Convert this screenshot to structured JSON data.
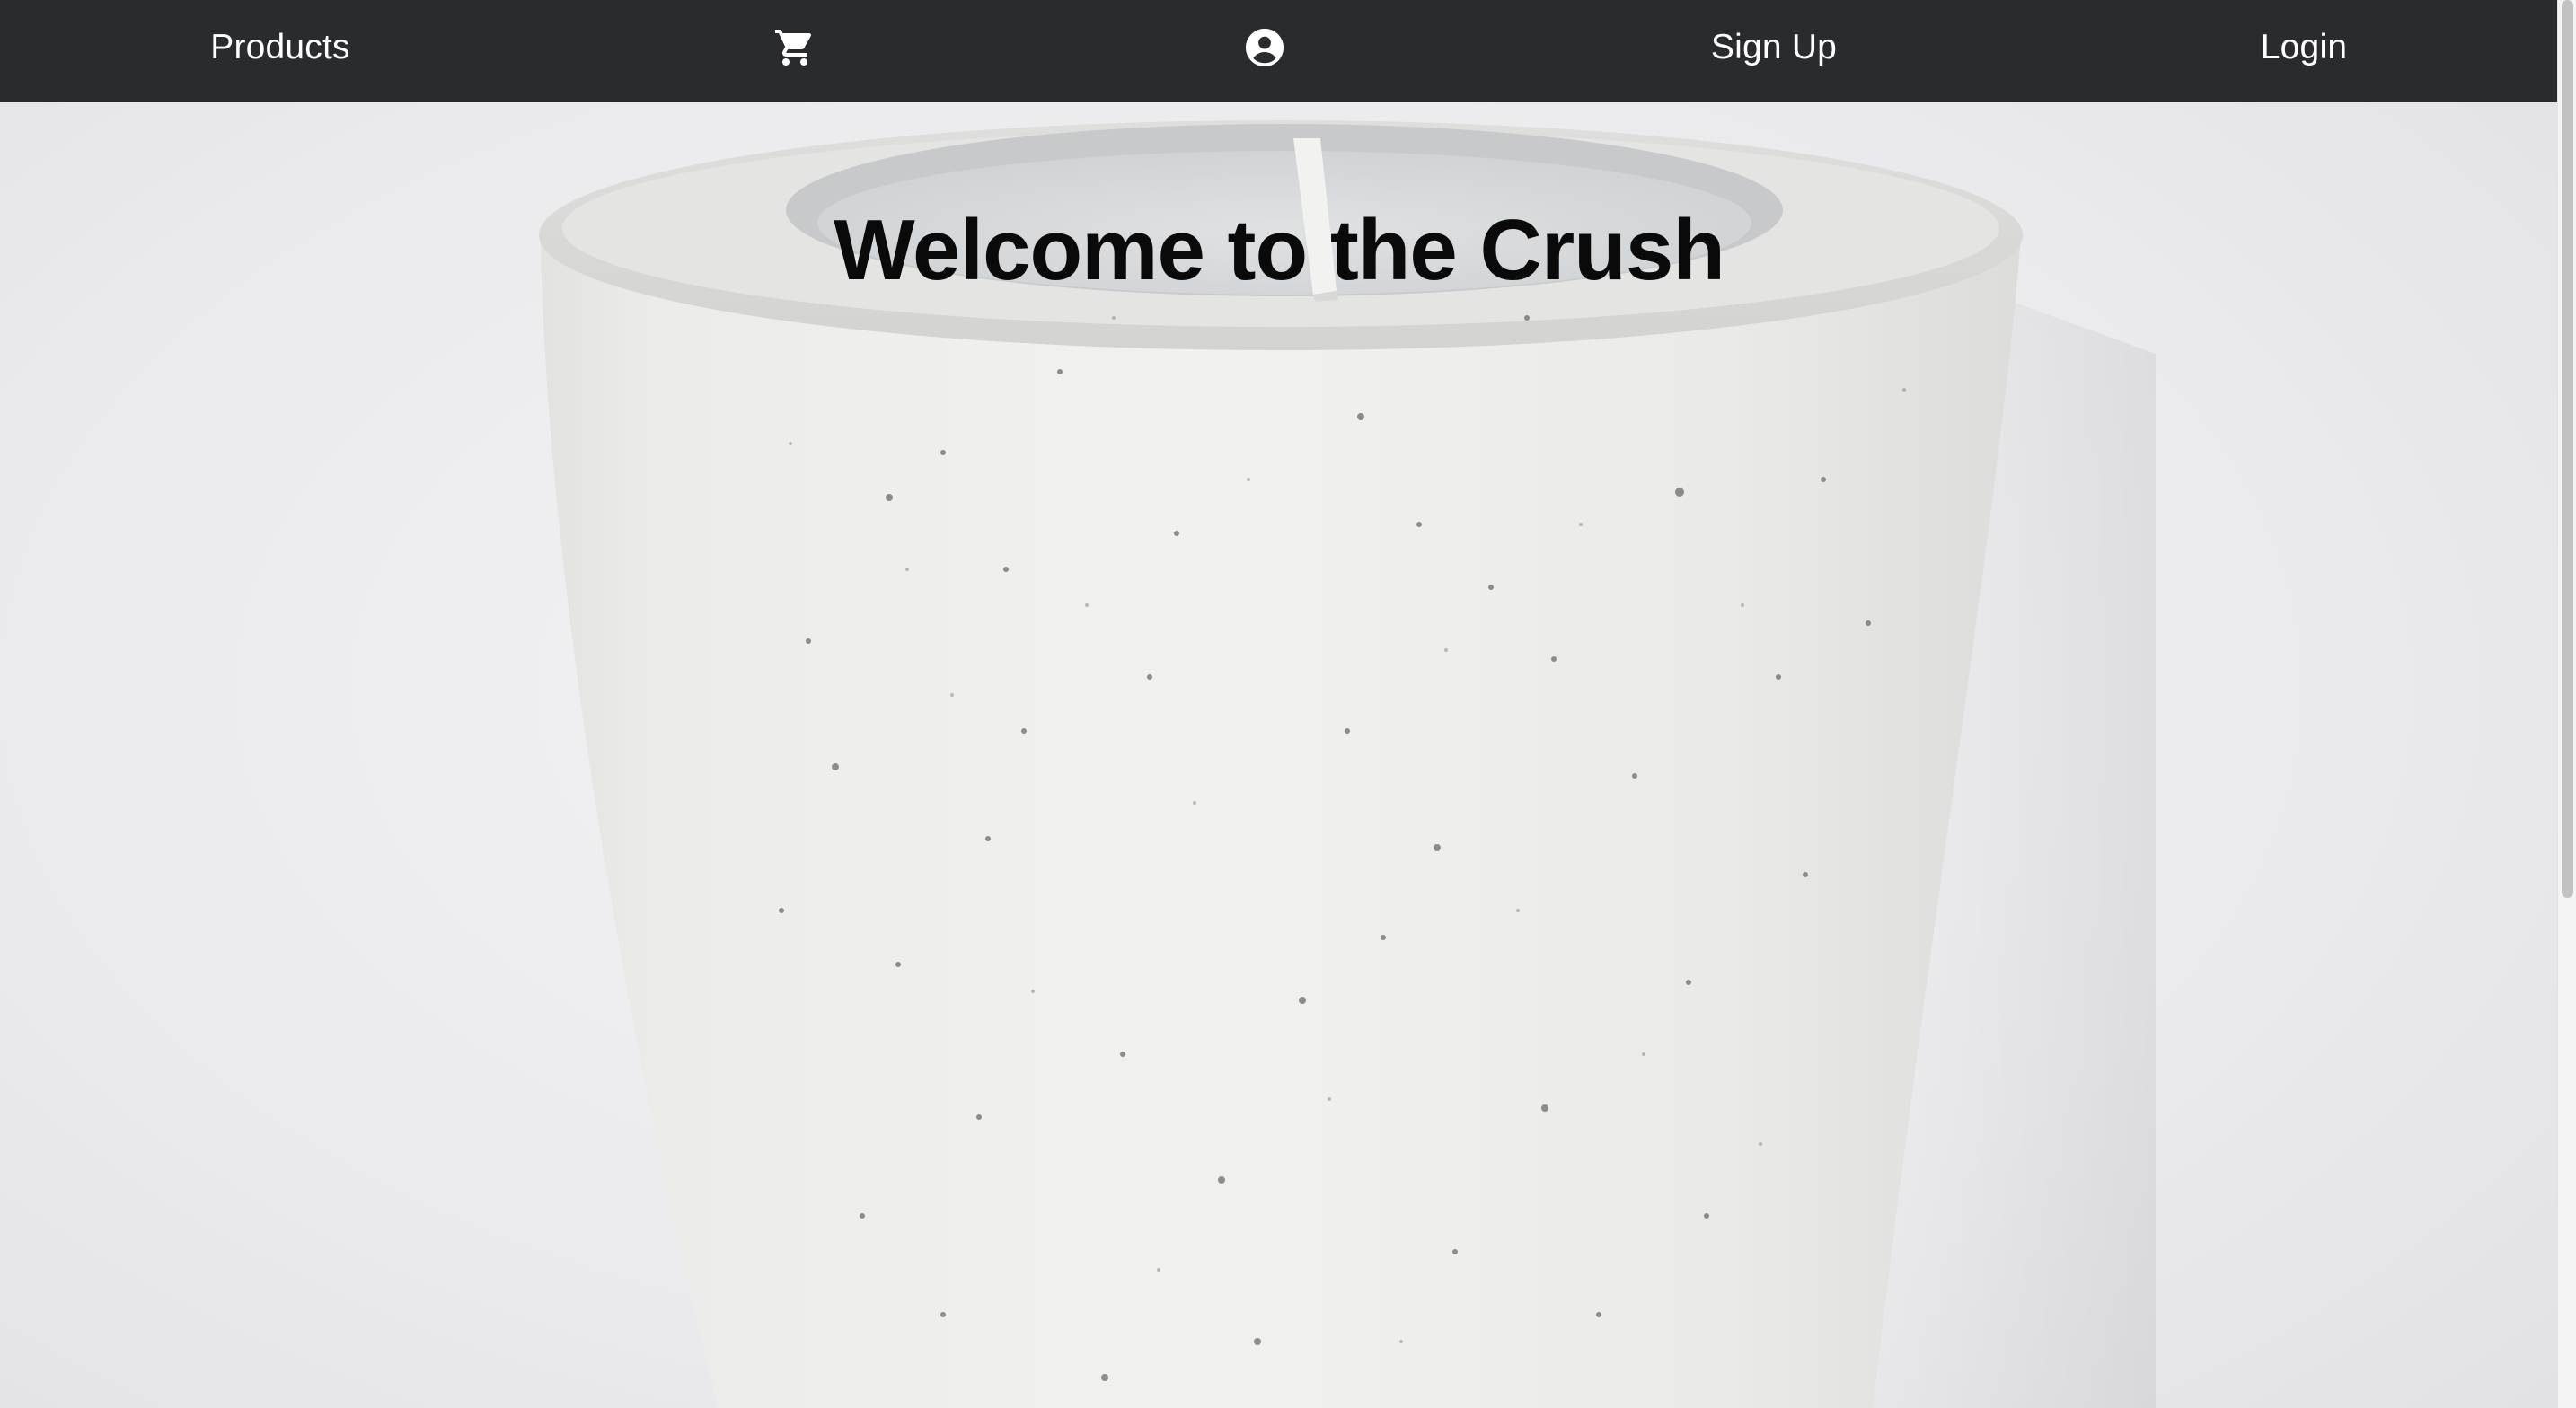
{
  "navbar": {
    "products_label": "Products",
    "cart_icon": "shopping-cart-icon",
    "account_icon": "user-circle-icon",
    "signup_label": "Sign Up",
    "login_label": "Login",
    "background_color": "#2a2b2e",
    "text_color": "#ffffff"
  },
  "hero": {
    "title": "Welcome to the Crush",
    "image": "white-concrete-candle-photo"
  }
}
